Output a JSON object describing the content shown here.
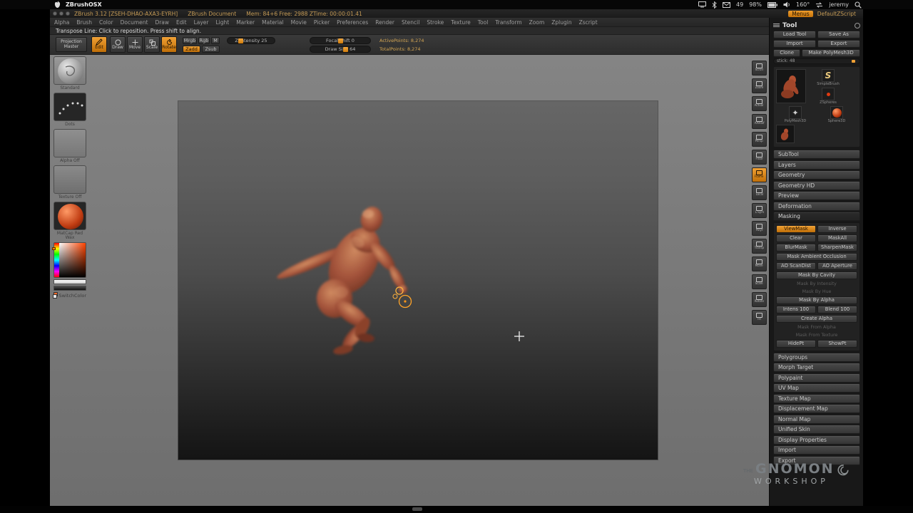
{
  "colors": {
    "accent": "#d98a1f",
    "clay": "#a85537",
    "panel": "#2d2d2d"
  },
  "menubar": {
    "app_name": "ZBrushOSX",
    "mail_badge": "49",
    "battery": "98%",
    "temp": "160°",
    "user": "jeremy"
  },
  "titlebar": {
    "title": "ZBrush 3.12 [ZSEH-DHAO-AXA3-EYRH]",
    "document": "ZBrush Document",
    "stats": "Mem: 84+6   Free: 2988   ZTime: 00:00:01.41",
    "menus": "Menus",
    "zscript": "DefaultZScript"
  },
  "menus": [
    "Alpha",
    "Brush",
    "Color",
    "Document",
    "Draw",
    "Edit",
    "Layer",
    "Light",
    "Marker",
    "Material",
    "Movie",
    "Picker",
    "Preferences",
    "Render",
    "Stencil",
    "Stroke",
    "Texture",
    "Tool",
    "Transform",
    "Zoom",
    "Zplugin",
    "Zscript"
  ],
  "hint": "Transpose Line: Click to reposition. Press shift to align.",
  "shelf": {
    "projection_master": "Projection Master",
    "edit": "Edit",
    "draw": "Draw",
    "move": "Move",
    "scale": "Scale",
    "rotate": "Rotate",
    "mrgb": "Mrgb",
    "rgb": "Rgb",
    "m": "M",
    "zadd": "Zadd",
    "zsub": "Zsub",
    "zintensity": "Z Intensity 25",
    "focal_shift": "Focal Shift 0",
    "draw_size": "Draw Size 64",
    "active_points": "ActivePoints: 8,274",
    "total_points": "TotalPoints: 8,274"
  },
  "left_shelf": {
    "items": [
      {
        "label": "Standard"
      },
      {
        "label": "Dots"
      },
      {
        "label": "Alpha Off"
      },
      {
        "label": "Texture Off"
      },
      {
        "label": "MatCap Red Wax"
      }
    ],
    "switch_color": "SwitchColor"
  },
  "right_strip": [
    {
      "label": "Scroll"
    },
    {
      "label": "Zoom"
    },
    {
      "label": "Actual"
    },
    {
      "label": "AAHalf"
    },
    {
      "label": "Persp"
    },
    {
      "label": "Floor"
    },
    {
      "label": "Frame",
      "active": true
    },
    {
      "label": "Local"
    },
    {
      "label": "L.Sym"
    },
    {
      "label": "PolyF"
    },
    {
      "label": "Transp"
    },
    {
      "label": "Move"
    },
    {
      "label": "Scale"
    },
    {
      "label": "Rotate"
    },
    {
      "label": "Fit"
    }
  ],
  "tool_palette": {
    "title": "Tool",
    "load_tool": "Load Tool",
    "save_as": "Save As",
    "import": "Import",
    "export": "Export",
    "clone": "Clone",
    "make_polymesh3d": "Make PolyMesh3D",
    "stick": "stick: 48",
    "inventory": {
      "simple_brush": "SimpleBrush",
      "zspheres": "ZSpheres",
      "polymesh3d": "PolyMesh3D",
      "sphere3d": "Sphere3D"
    },
    "sections_top": [
      {
        "label": "SubTool"
      },
      {
        "label": "Layers"
      },
      {
        "label": "Geometry"
      },
      {
        "label": "Geometry HD"
      },
      {
        "label": "Preview"
      },
      {
        "label": "Deformation"
      }
    ],
    "masking": {
      "header": "Masking",
      "view_mask": "ViewMask",
      "inverse": "Inverse",
      "clear": "Clear",
      "mask_all": "MaskAll",
      "blur_mask": "BlurMask",
      "sharpen_mask": "SharpenMask",
      "mask_ao": "Mask Ambient Occlusion",
      "ao_scandist": "AO ScanDist",
      "ao_aperture": "AO Aperture",
      "mask_by_cavity": "Mask By Cavity",
      "disabled_rows": [
        {
          "label": "Mask By Intensity"
        },
        {
          "label": "Mask By Hue"
        }
      ],
      "mask_by_alpha": "Mask By Alpha",
      "intensity": "Intens 100",
      "blend": "Blend 100",
      "create_alpha": "Create Alpha",
      "disabled_rows2": [
        {
          "label": "Mask From Alpha"
        },
        {
          "label": "Mask From Texture"
        }
      ],
      "hide_pt": "HidePt",
      "show_pt": "ShowPt"
    },
    "sections_bottom": [
      {
        "label": "Polygroups"
      },
      {
        "label": "Morph Target"
      },
      {
        "label": "Polypaint"
      },
      {
        "label": "UV Map"
      },
      {
        "label": "Texture Map"
      },
      {
        "label": "Displacement Map"
      },
      {
        "label": "Normal Map"
      },
      {
        "label": "Unified Skin"
      },
      {
        "label": "Display Properties"
      },
      {
        "label": "Import"
      },
      {
        "label": "Export"
      }
    ]
  },
  "watermark": {
    "the": "THE",
    "line1": "GNOMON",
    "line2": "WORKSHOP"
  }
}
